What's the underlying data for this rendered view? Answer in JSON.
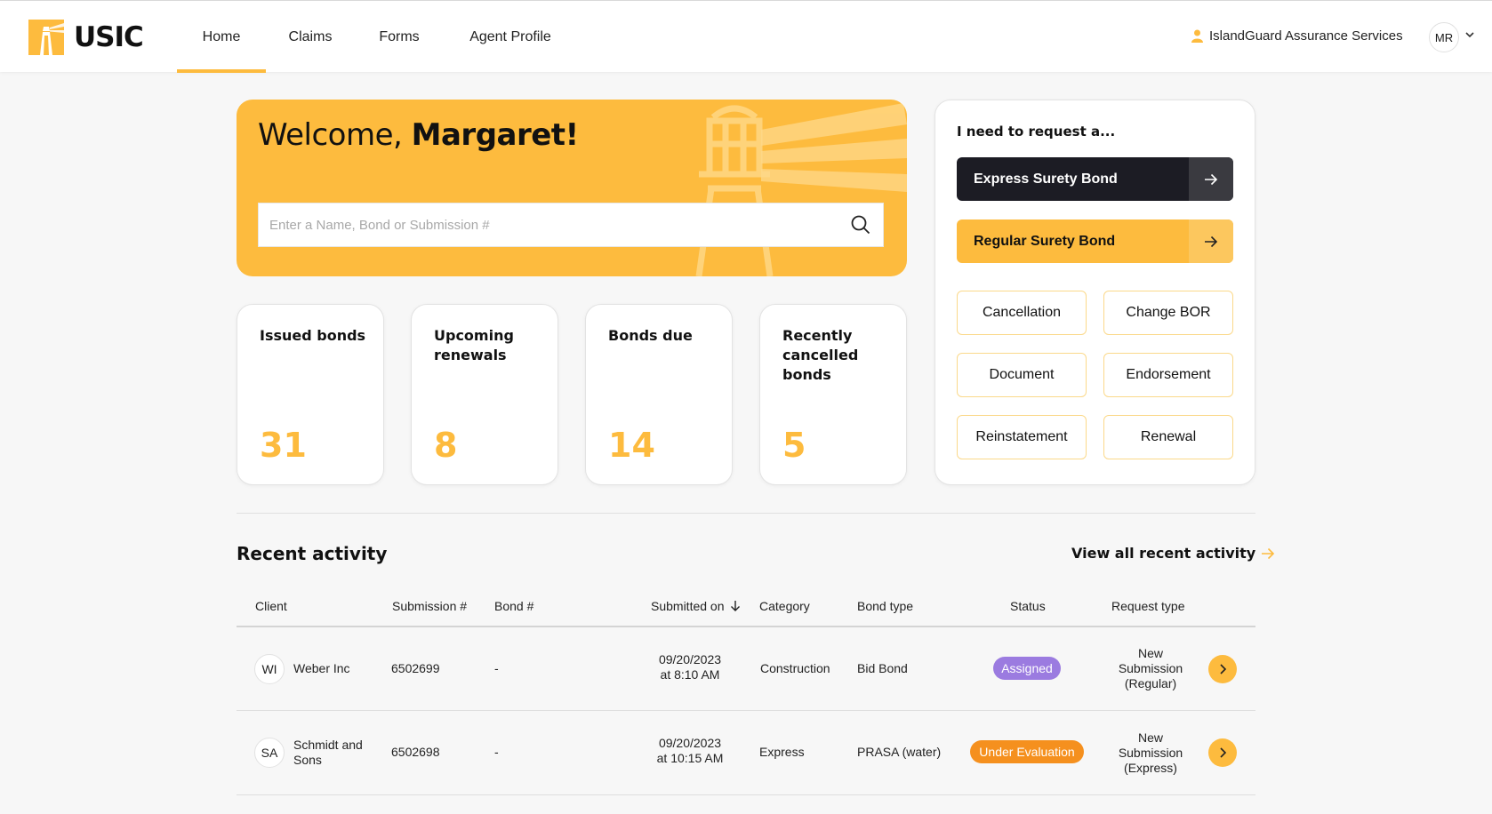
{
  "brand": {
    "name": "USIC",
    "accent": "#fdbb3e",
    "dark": "#1c1c24"
  },
  "nav": {
    "items": [
      {
        "label": "Home",
        "active": true
      },
      {
        "label": "Claims",
        "active": false
      },
      {
        "label": "Forms",
        "active": false
      },
      {
        "label": "Agent Profile",
        "active": false
      }
    ]
  },
  "user": {
    "agency": "IslandGuard Assurance Services",
    "initials": "MR"
  },
  "welcome": {
    "greeting": "Welcome,",
    "name": "Margaret!",
    "search_placeholder": "Enter a Name, Bond or Submission #"
  },
  "stats": [
    {
      "label": "Issued bonds",
      "value": "31"
    },
    {
      "label": "Upcoming renewals",
      "value": "8"
    },
    {
      "label": "Bonds due",
      "value": "14"
    },
    {
      "label": "Recently cancelled bonds",
      "value": "5"
    }
  ],
  "request": {
    "title": "I need to request a...",
    "primary": "Express Surety Bond",
    "secondary": "Regular Surety Bond",
    "options": [
      "Cancellation",
      "Change BOR",
      "Document",
      "Endorsement",
      "Reinstatement",
      "Renewal"
    ]
  },
  "recent": {
    "title": "Recent activity",
    "view_all": "View all recent activity",
    "columns": [
      "Client",
      "Submission #",
      "Bond #",
      "Submitted on",
      "Category",
      "Bond type",
      "Status",
      "Request type"
    ],
    "rows": [
      {
        "initials": "WI",
        "client": "Weber Inc",
        "submission": "6502699",
        "bond": "-",
        "date": "09/20/2023",
        "time": "at 8:10 AM",
        "category": "Construction",
        "bond_type": "Bid Bond",
        "status": "Assigned",
        "status_color": "#9b7be0",
        "req1": "New",
        "req2": "Submission",
        "req3": "(Regular)"
      },
      {
        "initials": "SA",
        "client1": "Schmidt and",
        "client2": "Sons",
        "submission": "6502698",
        "bond": "-",
        "date": "09/20/2023",
        "time": "at 10:15 AM",
        "category": "Express",
        "bond_type": "PRASA (water)",
        "status": "Under Evaluation",
        "status_color": "#f5901e",
        "req1": "New",
        "req2": "Submission",
        "req3": "(Express)"
      }
    ]
  }
}
